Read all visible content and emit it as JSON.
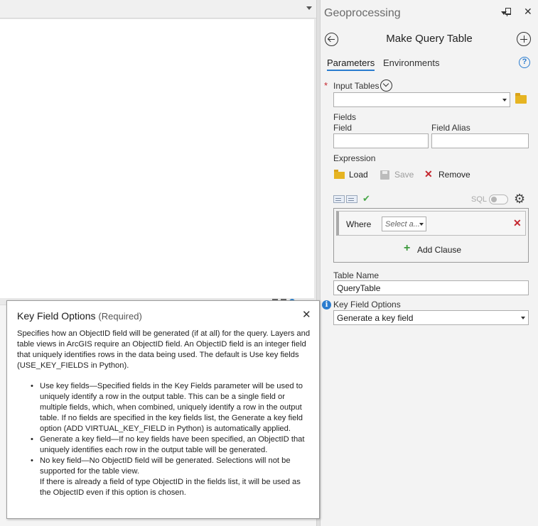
{
  "pane": {
    "title": "Geoprocessing",
    "tool_title": "Make Query Table",
    "tabs": [
      "Parameters",
      "Environments"
    ],
    "help": "?"
  },
  "params": {
    "input_tables_label": "Input Tables",
    "input_tables_value": "",
    "fields_label": "Fields",
    "field_col_label": "Field",
    "field_alias_col_label": "Field Alias",
    "expression_label": "Expression",
    "load_label": "Load",
    "save_label": "Save",
    "remove_label": "Remove",
    "sql_label": "SQL",
    "where_label": "Where",
    "select_placeholder": "Select a...",
    "add_clause_label": "Add Clause",
    "table_name_label": "Table Name",
    "table_name_value": "QueryTable",
    "key_field_label": "Key Field Options",
    "key_field_value": "Generate a key field"
  },
  "popup": {
    "title": "Key Field Options",
    "required": "(Required)",
    "intro": "Specifies how an ObjectID field will be generated (if at all) for the query. Layers and table views in ArcGIS require an ObjectID field. An ObjectID field is an integer field that uniquely identifies rows in the data being used. The default is Use key fields (USE_KEY_FIELDS in Python).",
    "bullets": [
      "Use key fields—Specified fields in the Key Fields parameter will be used to uniquely identify a row in the output table. This can be a single field or multiple fields, which, when combined, uniquely identify a row in the output table. If no fields are specified in the key fields list, the Generate a key field option (ADD VIRTUAL_KEY_FIELD in Python) is automatically applied.",
      "Generate a key field—If no key fields have been specified, an ObjectID that uniquely identifies each row in the output table will be generated.",
      "No key field—No ObjectID field will be generated. Selections will not be supported for the table view."
    ],
    "extra": "If there is already a field of type ObjectID in the fields list, it will be used as the ObjectID even if this option is chosen."
  }
}
